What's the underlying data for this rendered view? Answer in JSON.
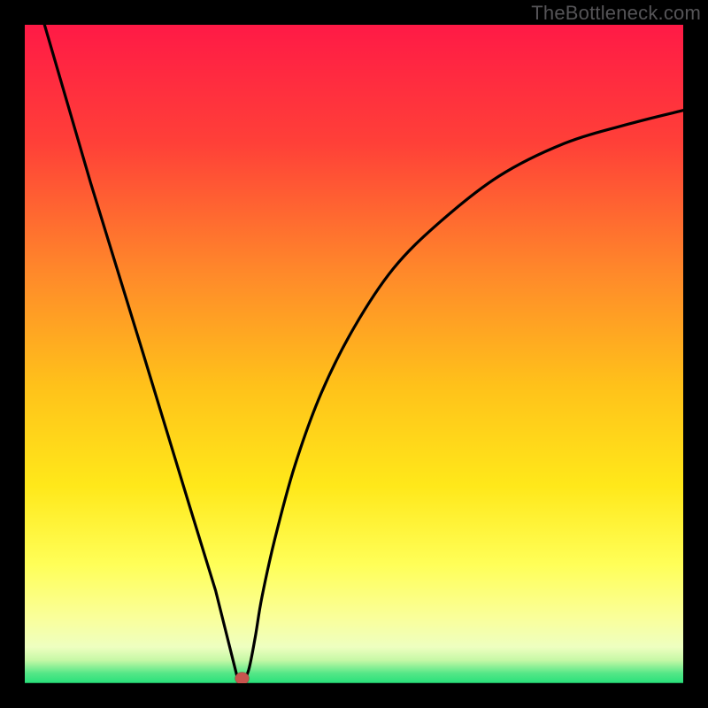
{
  "attribution": "TheBottleneck.com",
  "colors": {
    "top": "#ff1a46",
    "mid_upper": "#ff8a2a",
    "mid": "#ffd21a",
    "mid_lower": "#ffff58",
    "lower": "#f6ffb8",
    "bottom": "#28e07a",
    "black": "#000000",
    "curve": "#000000",
    "marker": "#c8544e"
  },
  "chart_data": {
    "type": "line",
    "title": "",
    "xlabel": "",
    "ylabel": "",
    "xlim": [
      0,
      100
    ],
    "ylim": [
      0,
      100
    ],
    "series": [
      {
        "name": "curve",
        "x": [
          3,
          10,
          18,
          25,
          29,
          31,
          32,
          32.5,
          33,
          34,
          35,
          36,
          38,
          41,
          45,
          50,
          56,
          63,
          72,
          82,
          92,
          100
        ],
        "values": [
          100,
          76,
          50,
          27,
          14,
          6,
          2,
          0,
          0,
          2,
          7,
          13,
          22,
          33,
          44,
          54,
          63,
          70,
          77,
          82,
          85,
          87
        ]
      }
    ],
    "marker": {
      "x": 33,
      "y": 1
    }
  }
}
